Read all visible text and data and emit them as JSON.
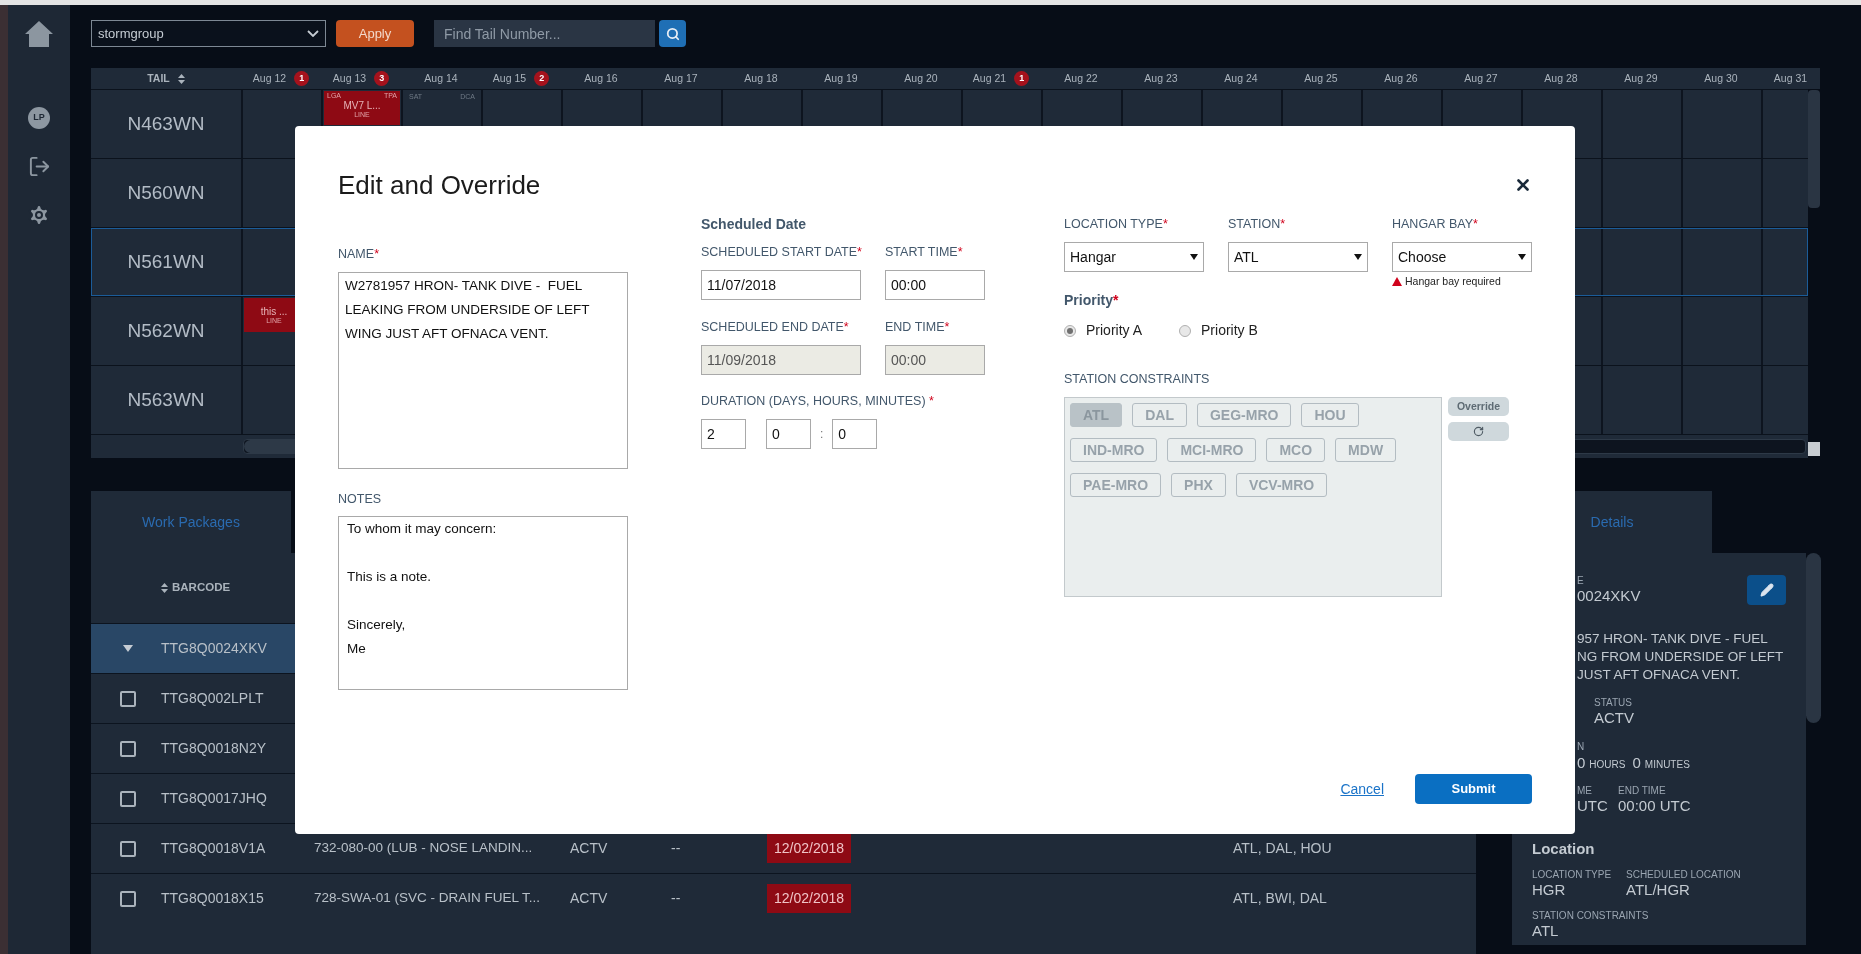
{
  "sidebar": {
    "items": [
      {
        "kind": "home"
      },
      {
        "kind": "avatar",
        "initials": "LP"
      },
      {
        "kind": "logout"
      },
      {
        "kind": "settings"
      }
    ]
  },
  "toolbar": {
    "group_select": {
      "value": "stormgroup"
    },
    "apply_button": "Apply",
    "search": {
      "placeholder": "Find Tail Number..."
    }
  },
  "calendar": {
    "tail_header": "TAIL",
    "days": [
      {
        "label": "Aug 12",
        "badge": "1"
      },
      {
        "label": "Aug 13",
        "badge": "3"
      },
      {
        "label": "Aug 14"
      },
      {
        "label": "Aug 15",
        "badge": "2"
      },
      {
        "label": "Aug 16"
      },
      {
        "label": "Aug 17"
      },
      {
        "label": "Aug 18"
      },
      {
        "label": "Aug 19"
      },
      {
        "label": "Aug 20"
      },
      {
        "label": "Aug 21",
        "badge": "1"
      },
      {
        "label": "Aug 22"
      },
      {
        "label": "Aug 23"
      },
      {
        "label": "Aug 24"
      },
      {
        "label": "Aug 25"
      },
      {
        "label": "Aug 26"
      },
      {
        "label": "Aug 27"
      },
      {
        "label": "Aug 28"
      },
      {
        "label": "Aug 29"
      },
      {
        "label": "Aug 30"
      },
      {
        "label": "Aug 31"
      }
    ],
    "rows": [
      {
        "tail": "N463WN",
        "selected": false,
        "cells": [
          {
            "kind": "empty"
          },
          {
            "kind": "event",
            "left": "LGA",
            "right": "TPA",
            "title": "MV7 L...",
            "type": "LINE"
          },
          {
            "kind": "stations",
            "left": "SAT",
            "right": "DCA"
          }
        ]
      },
      {
        "tail": "N560WN",
        "selected": false
      },
      {
        "tail": "N561WN",
        "selected": true
      },
      {
        "tail": "N562WN",
        "selected": false,
        "cells": [
          {
            "kind": "event",
            "title": "this ...",
            "type": "LINE"
          }
        ]
      },
      {
        "tail": "N563WN",
        "selected": false
      }
    ]
  },
  "work_packages": {
    "tab": {
      "label": "Work Packages",
      "selected": true
    },
    "columns": [
      {
        "label": "BARCODE"
      }
    ],
    "rows": [
      {
        "barcode": "TTG8Q0024XKV",
        "selected": true,
        "expanded": true
      },
      {
        "barcode": "TTG8Q002LPLT",
        "selected": false,
        "expanded": false,
        "checked": false
      },
      {
        "barcode": "TTG8Q0018N2Y",
        "selected": false,
        "expanded": false,
        "checked": false
      },
      {
        "barcode": "TTG8Q0017JHQ",
        "selected": false,
        "expanded": false,
        "checked": false
      },
      {
        "barcode": "TTG8Q0018V1A",
        "selected": false,
        "expanded": false,
        "checked": false,
        "description": "732-080-00 (LUB - NOSE LANDIN...",
        "status": "ACTV",
        "column_5": "--",
        "date": "12/02/2018",
        "locations": "ATL, DAL, HOU"
      },
      {
        "barcode": "TTG8Q0018X15",
        "selected": false,
        "expanded": false,
        "checked": false,
        "description": "728-SWA-01 (SVC - DRAIN FUEL T...",
        "status": "ACTV",
        "column_5": "--",
        "date": "12/02/2018",
        "locations": "ATL, BWI, DAL"
      }
    ]
  },
  "details": {
    "tab": {
      "label": "Details",
      "selected": true
    },
    "barcode_label": "E",
    "barcode": "0024XKV",
    "description_lines": [
      "957 HRON- TANK DIVE - FUEL",
      "NG FROM UNDERSIDE OF LEFT",
      "JUST AFT OFNACA VENT."
    ],
    "status": {
      "label": "STATUS",
      "value": "ACTV"
    },
    "duration": {
      "label": "N",
      "parts": [
        {
          "value": "0",
          "unit": "HOURS"
        },
        {
          "value": "0",
          "unit": "MINUTES"
        }
      ]
    },
    "times": [
      {
        "label": "ME",
        "value": "UTC"
      },
      {
        "label": "END TIME",
        "value": "00:00 UTC"
      }
    ],
    "location": {
      "title": "Location",
      "fields": [
        {
          "label": "LOCATION TYPE",
          "value": "HGR"
        },
        {
          "label": "SCHEDULED LOCATION",
          "value": "ATL/HGR"
        },
        {
          "label": "STATION CONSTRAINTS",
          "value": "ATL"
        }
      ]
    }
  },
  "modal": {
    "title": "Edit and Override",
    "name": {
      "label": "NAME",
      "mark": "*",
      "value": "W2781957 HRON- TANK DIVE -  FUEL LEAKING FROM UNDERSIDE OF LEFT WING JUST AFT OFNACA VENT."
    },
    "notes": {
      "label": "NOTES",
      "value": "To whom it may concern:\n\nThis is a note.\n\nSincerely,\nMe"
    },
    "schedule": {
      "title": "Scheduled Date",
      "fields": [
        {
          "label": "SCHEDULED START DATE",
          "mark": "*",
          "value": "11/07/2018",
          "disabled": false
        },
        {
          "label": "START TIME",
          "mark": "*",
          "value": "00:00",
          "disabled": false
        },
        {
          "label": "SCHEDULED END DATE",
          "mark": "*",
          "value": "11/09/2018",
          "disabled": true
        },
        {
          "label": "END TIME",
          "mark": "*",
          "value": "00:00",
          "disabled": true
        }
      ],
      "duration": {
        "label": "DURATION (DAYS, HOURS, MINUTES)",
        "mark": " *",
        "values": [
          "2",
          "0",
          "0"
        ],
        "separator": ":"
      }
    },
    "selects": [
      {
        "label": "LOCATION TYPE",
        "mark": "*",
        "value": "Hangar"
      },
      {
        "label": "STATION",
        "mark": "*",
        "value": "ATL"
      },
      {
        "label": "HANGAR BAY",
        "mark": "*",
        "value": "Choose",
        "error": "Hangar bay required"
      }
    ],
    "priority": {
      "label": "Priority",
      "mark": "*",
      "options": [
        {
          "label": "Priority A",
          "selected": true
        },
        {
          "label": "Priority B",
          "selected": false
        }
      ]
    },
    "constraints": {
      "label": "STATION CONSTRAINTS",
      "override_button": "Override",
      "stations": [
        {
          "code": "ATL",
          "selected": true
        },
        {
          "code": "DAL",
          "selected": false
        },
        {
          "code": "GEG-MRO",
          "selected": false
        },
        {
          "code": "HOU",
          "selected": false
        },
        {
          "code": "IND-MRO",
          "selected": false
        },
        {
          "code": "MCI-MRO",
          "selected": false
        },
        {
          "code": "MCO",
          "selected": false
        },
        {
          "code": "MDW",
          "selected": false
        },
        {
          "code": "PAE-MRO",
          "selected": false
        },
        {
          "code": "PHX",
          "selected": false
        },
        {
          "code": "VCV-MRO",
          "selected": false
        }
      ]
    },
    "actions": {
      "cancel": "Cancel",
      "submit": "Submit"
    }
  }
}
